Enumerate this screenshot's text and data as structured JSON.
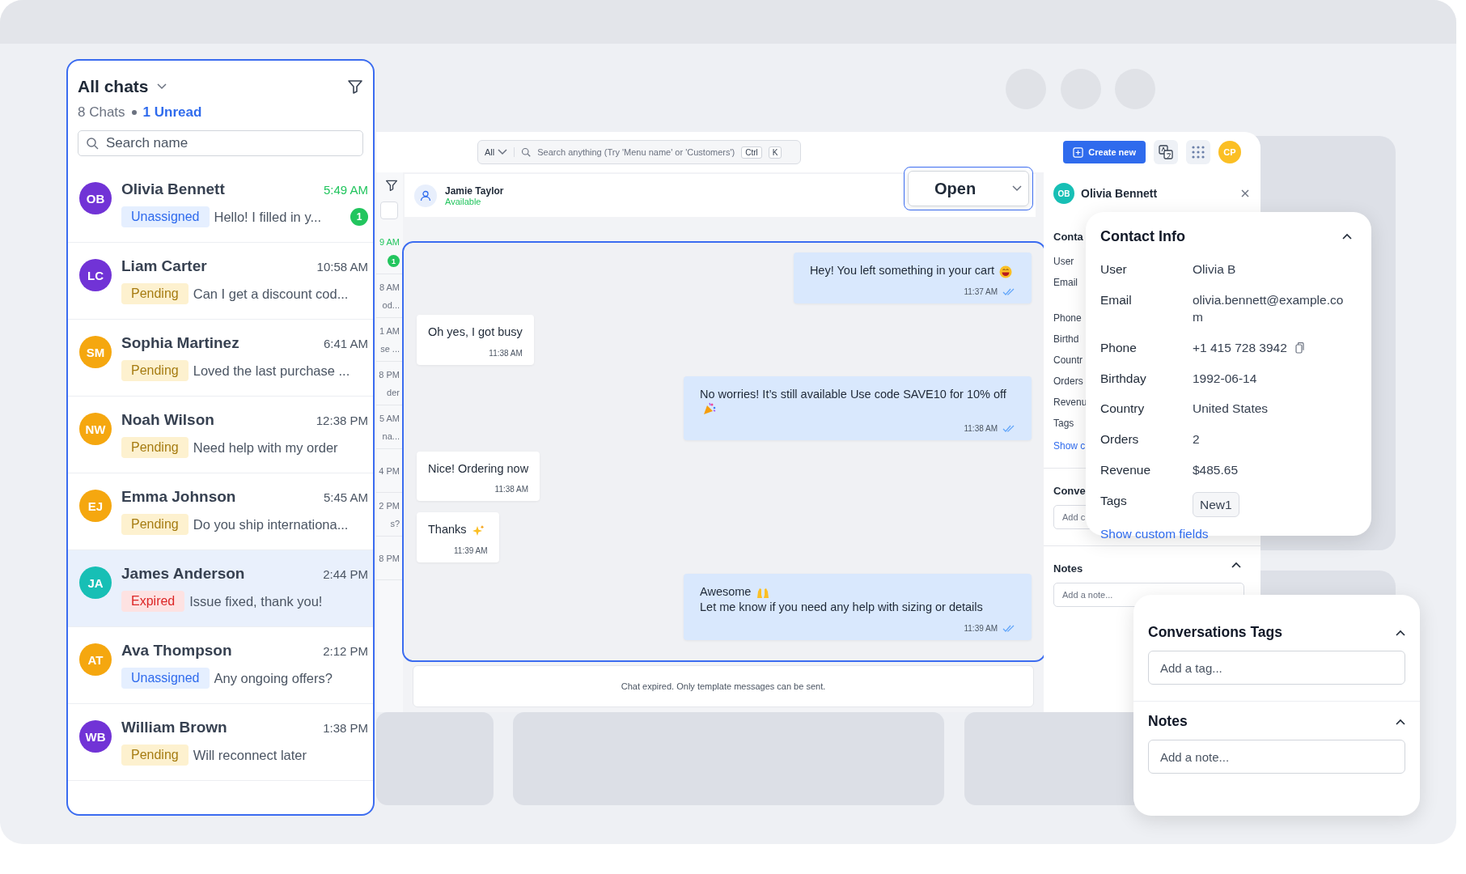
{
  "chat_list": {
    "title": "All chats",
    "count": "8 Chats",
    "unread": "1 Unread",
    "search": {
      "placeholder": "Search name"
    },
    "chats": [
      {
        "initials": "OB",
        "color": "#7133d6",
        "name": "Olivia Bennett",
        "time": "5:49 AM",
        "status": "Unassigned",
        "kind": "unassigned",
        "preview": "Hello! I filled in y...",
        "unread_count": "1",
        "selected": false
      },
      {
        "initials": "LC",
        "color": "#7133d6",
        "name": "Liam Carter",
        "time": "10:58 AM",
        "status": "Pending",
        "kind": "pending",
        "preview": "Can I get a discount cod...",
        "selected": false
      },
      {
        "initials": "SM",
        "color": "#f5a70f",
        "name": "Sophia Martinez",
        "time": "6:41 AM",
        "status": "Pending",
        "kind": "pending",
        "preview": "Loved the last purchase ...",
        "selected": false
      },
      {
        "initials": "NW",
        "color": "#f5a70f",
        "name": "Noah Wilson",
        "time": "12:38 PM",
        "status": "Pending",
        "kind": "pending",
        "preview": "Need help with my order",
        "selected": false
      },
      {
        "initials": "EJ",
        "color": "#f5a70f",
        "name": "Emma Johnson",
        "time": "5:45 AM",
        "status": "Pending",
        "kind": "pending",
        "preview": "Do you ship internationa...",
        "selected": false
      },
      {
        "initials": "JA",
        "color": "#17bfb5",
        "name": "James Anderson",
        "time": "2:44 PM",
        "status": "Expired",
        "kind": "expired",
        "preview": "Issue fixed, thank you!",
        "selected": true
      },
      {
        "initials": "AT",
        "color": "#f5a70f",
        "name": "Ava Thompson",
        "time": "2:12 PM",
        "status": "Unassigned",
        "kind": "unassigned",
        "preview": "Any ongoing offers?",
        "selected": false
      },
      {
        "initials": "WB",
        "color": "#7133d6",
        "name": "William Brown",
        "time": "1:38 PM",
        "status": "Pending",
        "kind": "pending",
        "preview": "Will reconnect later",
        "selected": false
      }
    ]
  },
  "toolbar": {
    "scope": "All",
    "search_placeholder": "Search anything (Try 'Menu name' or 'Customers')",
    "keys": [
      "Ctrl",
      "K"
    ],
    "create_button": "Create new",
    "avatar": "CP"
  },
  "background_list": [
    {
      "time": "9 AM",
      "unread_count": "1"
    },
    {
      "time": "8 AM",
      "preview": "od..."
    },
    {
      "time": "1 AM",
      "preview": "se ..."
    },
    {
      "time": "8 PM",
      "preview": "der"
    },
    {
      "time": "5 AM",
      "preview": "na..."
    },
    {
      "time": "4 PM"
    },
    {
      "time": "2 PM",
      "preview": "s?"
    },
    {
      "time": "8 PM"
    }
  ],
  "conversation": {
    "contact": {
      "name": "Jamie Taylor",
      "status": "Available"
    },
    "status_select": "Open",
    "messages": [
      {
        "kind": "outgoing",
        "text": "Hey! You left something in your cart",
        "emoji": {
          "kind": "grin"
        },
        "time": "11:37 AM"
      },
      {
        "kind": "incoming",
        "text": "Oh yes, I got busy",
        "time": "11:38 AM"
      },
      {
        "kind": "outgoing",
        "text": "No worries! It’s still available Use code SAVE10 for 10% off",
        "emoji": {
          "kind": "party"
        },
        "time": "11:38 AM"
      },
      {
        "kind": "incoming",
        "text": "Nice! Ordering now",
        "time": "11:38 AM"
      },
      {
        "kind": "incoming",
        "text": "Thanks",
        "emoji": {
          "kind": "sparkles"
        },
        "time": "11:39 AM"
      },
      {
        "kind": "outgoing",
        "text": "Awesome",
        "emoji": {
          "kind": "hands"
        },
        "text_after": "Let me know if you need any help with sizing or details",
        "time": "11:39 AM"
      }
    ],
    "footer": "Chat expired. Only template messages can be sent."
  },
  "details_panel": {
    "contact": {
      "initials": "OB",
      "name": "Olivia Bennett"
    },
    "section": "Conta",
    "labels": [
      "User",
      "Email",
      "Phone",
      "Birthd",
      "Countr",
      "Orders",
      "Revenu",
      "Tags"
    ],
    "link": "Show c",
    "conversations": "Conve",
    "tag_placeholder": "Add c",
    "notes": "Notes",
    "note_placeholder": "Add a note..."
  },
  "contact_info": {
    "title": "Contact Info",
    "fields": [
      {
        "label": "User",
        "value": "Olivia B",
        "kind": "text"
      },
      {
        "label": "Email",
        "value": "olivia.bennett@example.com",
        "kind": "text"
      },
      {
        "label": "Phone",
        "value": "+1 415 728 3942",
        "kind": "copy"
      },
      {
        "label": "Birthday",
        "value": "1992-06-14",
        "kind": "text"
      },
      {
        "label": "Country",
        "value": "United States",
        "kind": "text"
      },
      {
        "label": "Orders",
        "value": "2",
        "kind": "text"
      },
      {
        "label": "Revenue",
        "value": "$485.65",
        "kind": "text"
      },
      {
        "label": "Tags",
        "value": "New1",
        "kind": "tag"
      }
    ],
    "link": "Show custom fields"
  },
  "tag_panel": {
    "sections": [
      {
        "title": "Conversations Tags",
        "placeholder": "Add a tag..."
      },
      {
        "title": "Notes",
        "placeholder": "Add a note..."
      }
    ]
  }
}
